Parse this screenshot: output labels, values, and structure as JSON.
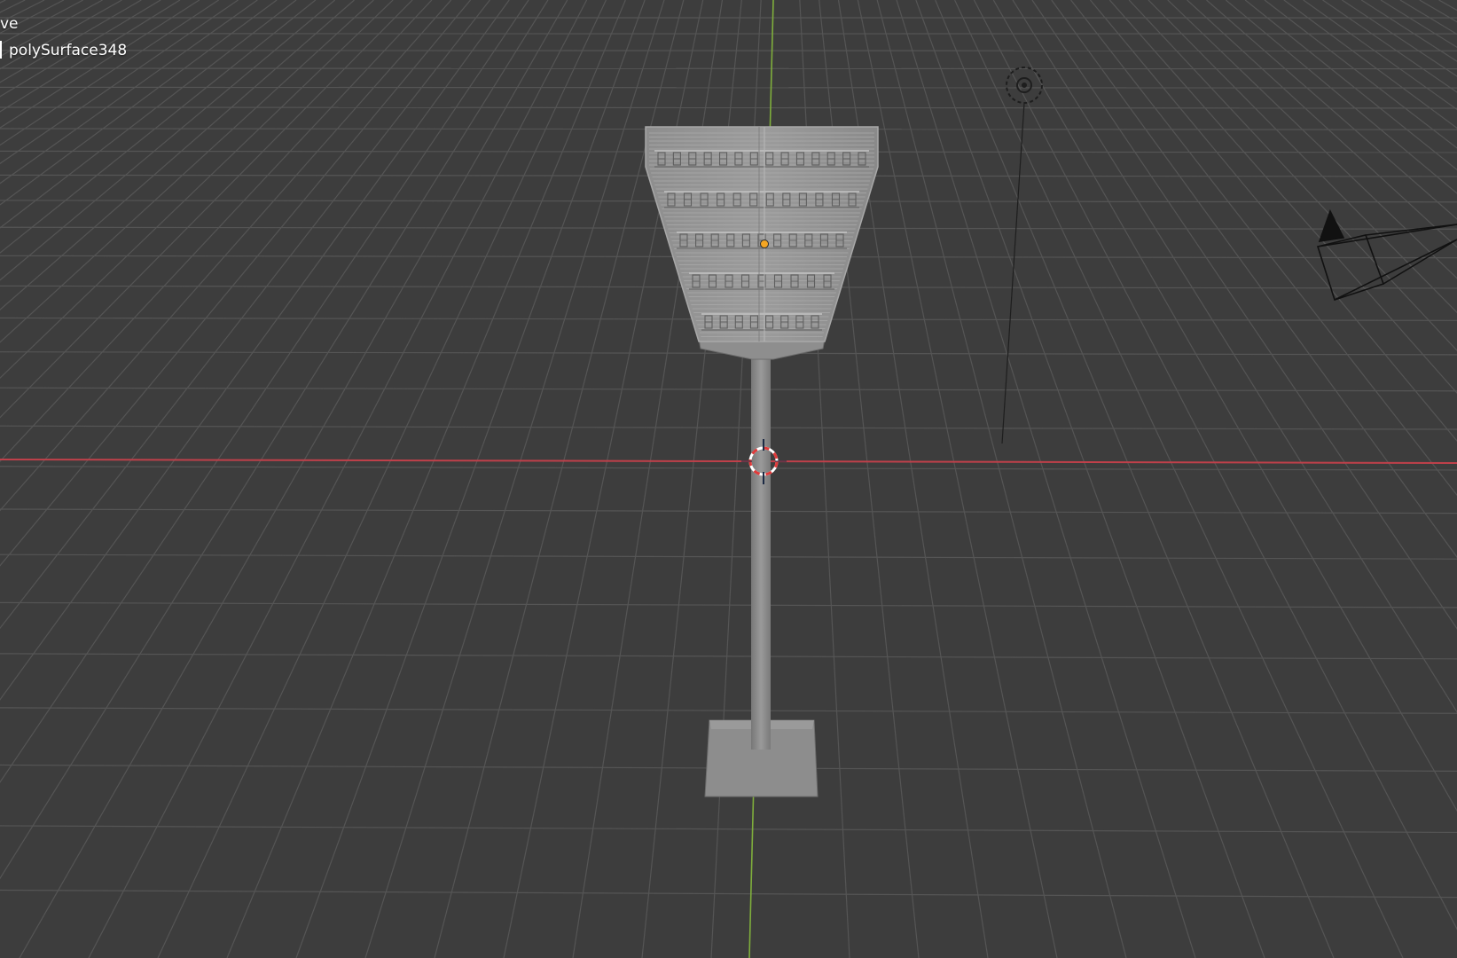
{
  "viewport": {
    "view_mode_label": "ve",
    "object_name": "polySurface348",
    "background_color": "#3d3d3d",
    "grid_color": "#555555",
    "x_axis_color": "#c0404a",
    "y_axis_color": "#7fae3c",
    "origin_color": "#f5a623",
    "mesh_color": "#8a8a8a",
    "mesh_edge_color": "#bdbdbd"
  },
  "icons": {
    "light": "light-icon",
    "camera": "camera-icon",
    "cursor": "3d-cursor-icon",
    "origin": "object-origin-icon"
  }
}
